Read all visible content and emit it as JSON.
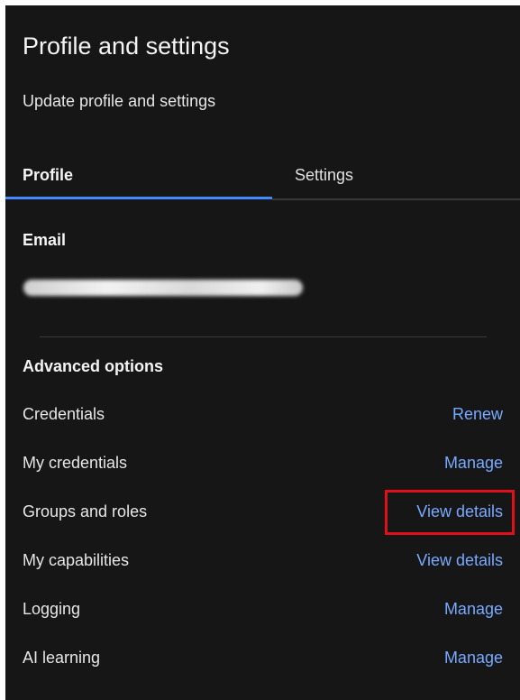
{
  "header": {
    "title": "Profile and settings",
    "subtitle": "Update profile and settings"
  },
  "tabs": [
    {
      "label": "Profile",
      "selected": true
    },
    {
      "label": "Settings",
      "selected": false
    }
  ],
  "email": {
    "label": "Email",
    "value": "",
    "redacted": true
  },
  "advanced": {
    "label": "Advanced options",
    "rows": [
      {
        "label": "Credentials",
        "action": "Renew"
      },
      {
        "label": "My credentials",
        "action": "Manage"
      },
      {
        "label": "Groups and roles",
        "action": "View details"
      },
      {
        "label": "My capabilities",
        "action": "View details"
      },
      {
        "label": "Logging",
        "action": "Manage"
      },
      {
        "label": "AI learning",
        "action": "Manage"
      }
    ]
  },
  "colors": {
    "background": "#161616",
    "text": "#f4f4f4",
    "link": "#78a9ff",
    "tab_indicator": "#4589ff",
    "highlight": "#e0101a"
  }
}
